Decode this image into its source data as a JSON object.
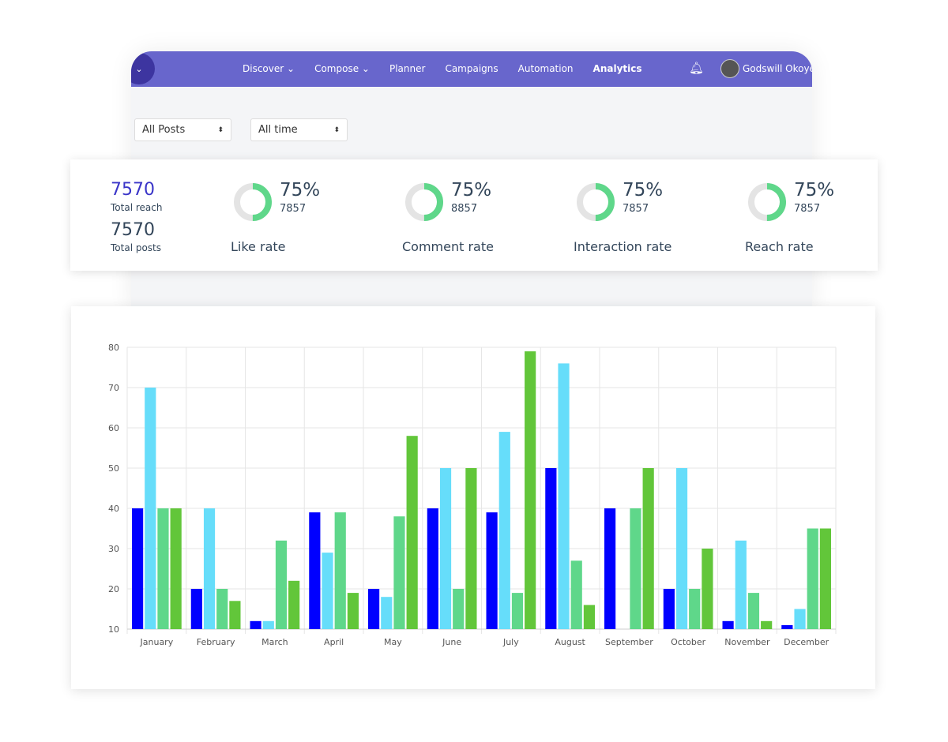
{
  "nav": {
    "items": [
      "Discover",
      "Compose",
      "Planner",
      "Campaigns",
      "Automation",
      "Analytics"
    ],
    "active": "Analytics",
    "user": "Godswill Okoye",
    "color": "#6866cc"
  },
  "filters": {
    "posts": "All Posts",
    "time": "All time"
  },
  "summary": {
    "reach_value": "7570",
    "reach_label": "Total reach",
    "posts_value": "7570",
    "posts_label": "Total posts"
  },
  "metrics": [
    {
      "percent": "75%",
      "count": "7857",
      "label": "Like rate",
      "ring_fill": 0.5
    },
    {
      "percent": "75%",
      "count": "8857",
      "label": "Comment rate",
      "ring_fill": 0.5
    },
    {
      "percent": "75%",
      "count": "7857",
      "label": "Interaction rate",
      "ring_fill": 0.5
    },
    {
      "percent": "75%",
      "count": "7857",
      "label": "Reach rate",
      "ring_fill": 0.5
    }
  ],
  "chart_data": {
    "type": "bar",
    "categories": [
      "January",
      "February",
      "March",
      "April",
      "May",
      "June",
      "July",
      "August",
      "September",
      "October",
      "November",
      "December"
    ],
    "series": [
      {
        "color": "#0000ff",
        "values": [
          40,
          20,
          12,
          39,
          20,
          40,
          39,
          50,
          40,
          20,
          12,
          11
        ]
      },
      {
        "color": "#66ddfa",
        "values": [
          70,
          40,
          12,
          29,
          18,
          50,
          59,
          76,
          10,
          50,
          32,
          15
        ]
      },
      {
        "color": "#5fd78a",
        "values": [
          40,
          20,
          32,
          39,
          38,
          20,
          19,
          27,
          40,
          20,
          19,
          35
        ]
      },
      {
        "color": "#62c63a",
        "values": [
          40,
          17,
          22,
          19,
          58,
          50,
          79,
          16,
          50,
          30,
          12,
          35
        ]
      }
    ],
    "ylim": [
      10,
      80
    ],
    "yticks": [
      10,
      20,
      30,
      40,
      50,
      60,
      70,
      80
    ],
    "grid": true
  }
}
